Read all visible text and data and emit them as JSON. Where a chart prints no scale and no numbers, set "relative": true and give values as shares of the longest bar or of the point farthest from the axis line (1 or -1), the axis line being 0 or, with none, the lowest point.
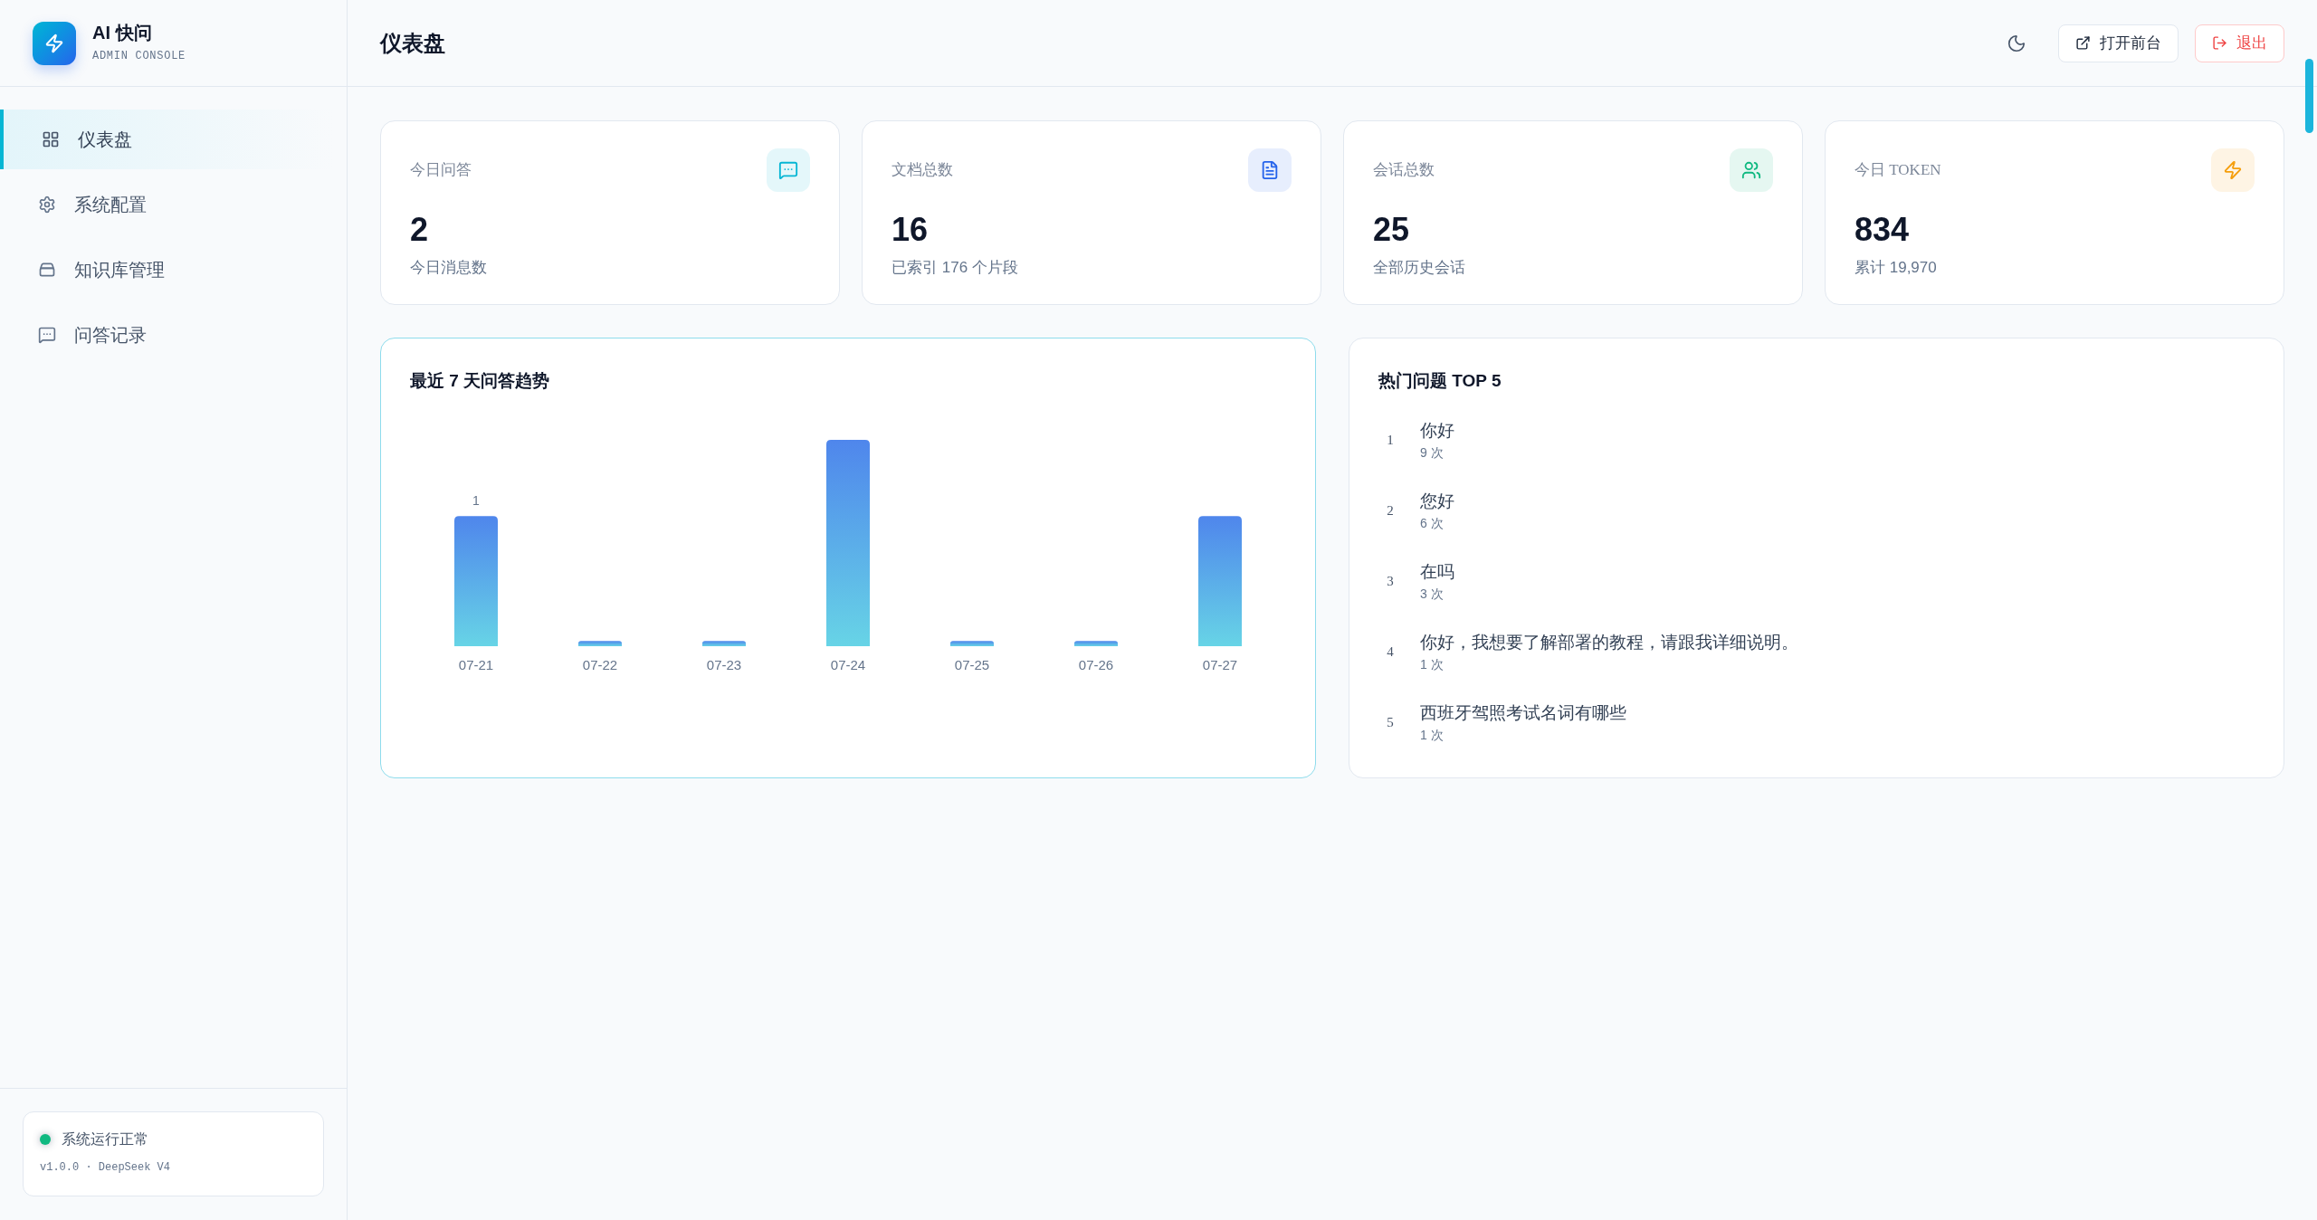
{
  "brand": {
    "name": "AI 快问",
    "subtitle": "ADMIN CONSOLE"
  },
  "sidebar": {
    "items": [
      {
        "label": "仪表盘",
        "selected": true
      },
      {
        "label": "系统配置",
        "selected": false
      },
      {
        "label": "知识库管理",
        "selected": false
      },
      {
        "label": "问答记录",
        "selected": false
      }
    ]
  },
  "status": {
    "online": true,
    "label": "系统运行正常",
    "version": "v1.0.0 · DeepSeek V4"
  },
  "header": {
    "title": "仪表盘",
    "buttons": [
      {
        "label": "打开前台",
        "kind": "outline"
      },
      {
        "label": "退出",
        "kind": "danger"
      }
    ]
  },
  "stats": [
    {
      "label": "今日问答",
      "value": "2",
      "note": "今日消息数",
      "color": "#06b6d4"
    },
    {
      "label": "文档总数",
      "value": "16",
      "note": "已索引 176 个片段",
      "color": "#2563eb"
    },
    {
      "label": "会话总数",
      "value": "25",
      "note": "全部历史会话",
      "color": "#10b981"
    },
    {
      "label": "今日 TOKEN",
      "value": "834",
      "note": "累计 19,970",
      "color": "#f59e0b"
    }
  ],
  "trend": {
    "title": "最近 7 天问答趋势",
    "chart_data": {
      "type": "bar",
      "relative": true,
      "categories": [
        "07-21",
        "07-22",
        "07-23",
        "07-24",
        "07-25",
        "07-26",
        "07-27"
      ],
      "values": [
        0.63,
        0.025,
        0.025,
        1,
        0.025,
        0.025,
        0.63
      ],
      "annotations": [
        {
          "x": "07-21",
          "y": 0.63,
          "text": "1"
        }
      ]
    }
  },
  "top_questions": {
    "title": "热门问题 TOP 5",
    "items": [
      {
        "rank": "1",
        "question": "你好",
        "count": "9 次"
      },
      {
        "rank": "2",
        "question": "您好",
        "count": "6 次"
      },
      {
        "rank": "3",
        "question": "在吗",
        "count": "3 次"
      },
      {
        "rank": "4",
        "question": "你好，我想要了解部署的教程，请跟我详细说明。",
        "count": "1 次"
      },
      {
        "rank": "5",
        "question": "西班牙驾照考试名词有哪些",
        "count": "1 次"
      }
    ]
  }
}
